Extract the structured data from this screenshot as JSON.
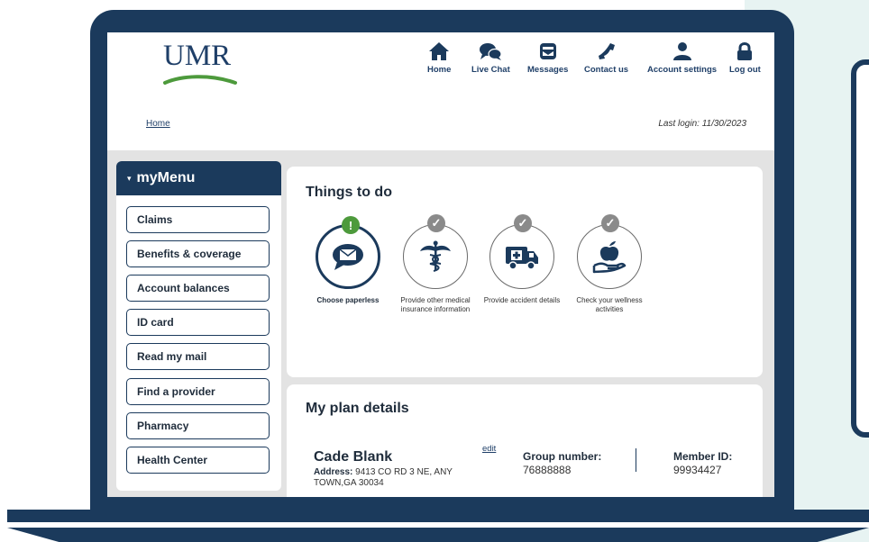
{
  "brand": {
    "logo_text": "UMR",
    "navy": "#1b3a5c",
    "green": "#4d9a3c",
    "accent_bg": "#e7f3f2"
  },
  "header": {
    "nav": [
      {
        "label": "Home",
        "icon": "home-icon"
      },
      {
        "label": "Live Chat",
        "icon": "chat-icon"
      },
      {
        "label": "Messages",
        "icon": "envelope-icon"
      },
      {
        "label": "Contact us",
        "icon": "phone-icon"
      },
      {
        "label": "Account settings",
        "icon": "user-icon"
      },
      {
        "label": "Log out",
        "icon": "lock-icon"
      }
    ],
    "breadcrumb": "Home",
    "last_login": "Last login: 11/30/2023"
  },
  "menu": {
    "caret": "▾",
    "title": "myMenu",
    "items": [
      "Claims",
      "Benefits & coverage",
      "Account balances",
      "ID card",
      "Read my mail",
      "Find a provider",
      "Pharmacy",
      "Health Center"
    ]
  },
  "things_to_do": {
    "title": "Things to do",
    "tasks": [
      {
        "label": "Choose paperless",
        "status": "alert",
        "badge": "!",
        "icon": "paperless-chat-icon"
      },
      {
        "label": "Provide other medical insurance information",
        "status": "done",
        "badge": "✓",
        "icon": "caduceus-icon"
      },
      {
        "label": "Provide accident details",
        "status": "done",
        "badge": "✓",
        "icon": "ambulance-icon"
      },
      {
        "label": "Check your wellness activities",
        "status": "done",
        "badge": "✓",
        "icon": "apple-hand-icon"
      }
    ]
  },
  "plan_details": {
    "title": "My plan details",
    "name": "Cade Blank",
    "address_label": "Address:",
    "address": "9413 CO RD 3 NE, ANY TOWN,GA 30034",
    "edit": "edit",
    "group_label": "Group number:",
    "group_number": "76888888",
    "member_label": "Member ID:",
    "member_id": "99934427"
  }
}
